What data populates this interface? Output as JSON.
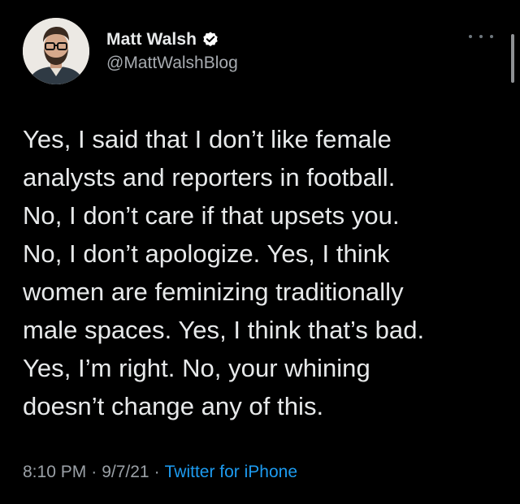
{
  "user": {
    "display_name": "Matt Walsh",
    "handle": "@MattWalshBlog",
    "verified": true,
    "verified_icon": "verified-badge-icon",
    "avatar_icon": "avatar"
  },
  "tweet": {
    "text": "Yes, I said that I don’t like female\nanalysts and reporters in football.\nNo, I don’t care if that upsets you.\nNo, I don’t apologize. Yes, I think\nwomen are feminizing traditionally\nmale spaces. Yes, I think that’s bad.\nYes, I’m right. No, your whining\ndoesn’t change any of this."
  },
  "meta": {
    "time": "8:10 PM",
    "separator_1": "·",
    "date": "9/7/21",
    "separator_2": "·",
    "source": "Twitter for iPhone"
  },
  "colors": {
    "background": "#000000",
    "text": "#e7e9ea",
    "secondary": "#9aa0a6",
    "accent": "#1d9bf0"
  },
  "more_menu_icon": "more-dots-icon"
}
